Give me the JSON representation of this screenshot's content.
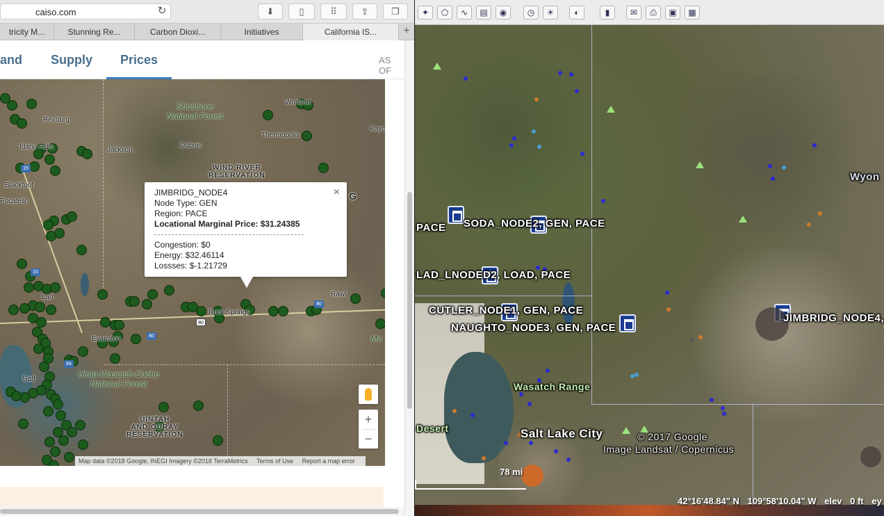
{
  "browser": {
    "url": "caiso.com",
    "tabs": [
      "tricity M...",
      "Stunning Re...",
      "Carbon Dioxi...",
      "Initiatives",
      "California IS..."
    ],
    "active_tab": 4
  },
  "nav": {
    "items": [
      "and",
      "Supply",
      "Prices"
    ],
    "active": "Prices",
    "as_of": "AS OF"
  },
  "map": {
    "labels": {
      "shoshone": "Shoshone\nNational Forest",
      "wind_river": "WIND RIVER\nRESERVATION",
      "uinta": "Uinta-Wasatch-Cache\nNational Forest",
      "uintah": "UINTAH\nAND OURAY\nRESERVATION",
      "rexburg": "Rexburg",
      "idaho_falls": "Idaho Falls",
      "jackson": "Jackson",
      "dubois": "Dubois",
      "thermopolis": "Thermopolis",
      "worland": "Worland",
      "blackfoot": "Blackfoot",
      "pocatello": "Pocatello",
      "evanston": "Evanston",
      "rock_springs": "Rock Springs",
      "rawlins": "Rawl",
      "salt": "Salt",
      "wyoming_g": "G",
      "kayc": "Kayc",
      "me": "Me",
      "lan": "Lan"
    },
    "highways": {
      "i15a": "15",
      "i15b": "15",
      "i80a": "80",
      "i80b": "80",
      "i80c": "80",
      "i84": "84"
    },
    "popup": {
      "node": "JIMBRIDG_NODE4",
      "node_type": "Node Type: GEN",
      "region": "Region: PACE",
      "lmp": "Locational Marginal Price: $31.24385",
      "congestion": "Congestion: $0",
      "energy": "Energy: $32.46114",
      "losses": "Lossses: $-1.21729",
      "close": "×"
    },
    "zoom_in": "+",
    "zoom_out": "−",
    "attribution": [
      "Map data ©2018 Google, INEGI Imagery ©2018 TerraMetrics",
      "Terms of Use",
      "Report a map error"
    ],
    "node_color": "#1d5a1d"
  },
  "earth": {
    "toolbar_icons": [
      "placemark-icon",
      "polygon-icon",
      "path-icon",
      "overlay-icon",
      "tour-icon",
      "history-icon",
      "sun-icon",
      "planet-icon",
      "ruler-icon",
      "email-icon",
      "print-icon",
      "save-image-icon",
      "maps-icon"
    ],
    "labels": {
      "pace_left": "PACE",
      "soda": "SODA_NODE2, GEN, PACE",
      "lad": "LAD_LNODED2, LOAD, PACE",
      "cutler": "CUTLER_NODE1, GEN, PACE",
      "naughto": "NAUGHTO_NODE3, GEN, PACE",
      "jimbridg": "JIMBRIDG_NODE4,",
      "wyom": "Wyon",
      "wasatch": "Wasatch Range",
      "desert": "Desert",
      "slc": "Salt Lake City",
      "copy1": "© 2017 Google",
      "copy2": "Image Landsat / Copernicus",
      "scale": "78 mi"
    },
    "status": {
      "lat": "42°16'48.84\" N",
      "lon": "109°58'10.04\" W",
      "elev_label": "elev",
      "elev": "0 ft",
      "eye": "ey"
    }
  }
}
